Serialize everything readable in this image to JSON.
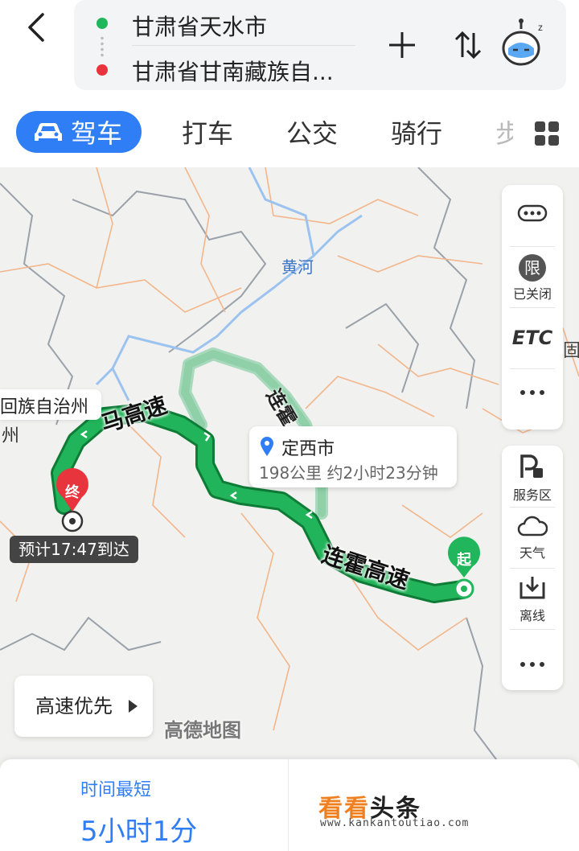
{
  "header": {
    "start": "甘肃省天水市",
    "end": "甘肃省甘南藏族自..."
  },
  "tabs": [
    {
      "label": "驾车"
    },
    {
      "label": "打车"
    },
    {
      "label": "公交"
    },
    {
      "label": "骑行"
    },
    {
      "label": "步"
    }
  ],
  "map": {
    "river_label": "黄河",
    "road_label_top": "连霍",
    "road_label_main": "连霍高速",
    "road_label_left": "马高速",
    "area_label": "回族自治州",
    "area_label_2": "州",
    "callout": {
      "title": "定西市",
      "subtitle": "198公里 约2小时23分钟"
    },
    "end_marker": "终",
    "start_marker": "起",
    "eta": "预计17:47到达",
    "watermark": "高德地图",
    "side_top": {
      "limit_icon": "限",
      "limit_label": "已关闭",
      "etc_label": "ETC"
    },
    "side_bottom": {
      "service_label": "服务区",
      "weather_label": "天气",
      "offline_label": "离线"
    },
    "preference": "高速优先",
    "edge_label": "固原"
  },
  "bottom": {
    "label": "时间最短",
    "time": "5小时1分",
    "brand_a": "看看",
    "brand_b": "头条",
    "url": "www.kankantoutiao.com"
  },
  "colors": {
    "accent": "#2f7ef5",
    "route": "#1aa34a",
    "alt_route": "#8fd0a8",
    "start": "#21b65b",
    "end": "#e8353d"
  }
}
